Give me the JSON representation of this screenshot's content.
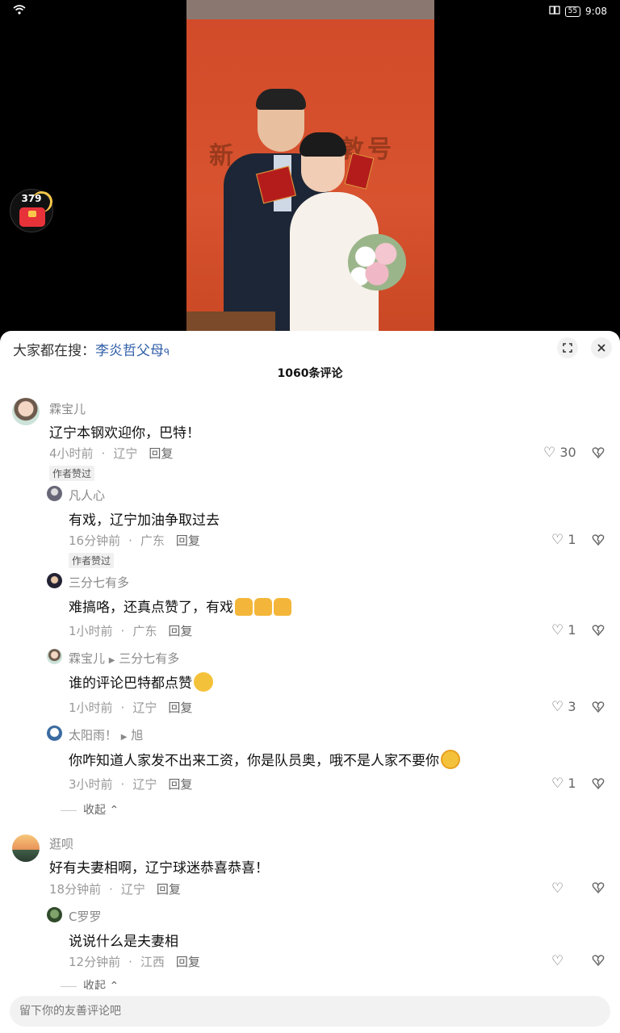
{
  "status_bar": {
    "time": "9:08",
    "battery": "55"
  },
  "red_packet": {
    "count": "379"
  },
  "search": {
    "prefix": "大家都在搜：",
    "keyword": "李炎哲父母"
  },
  "comments_count": "1060条评论",
  "comments": [
    {
      "name": "霖宝儿",
      "text": "辽宁本钢欢迎你，巴特！",
      "time": "4小时前",
      "region": "辽宁",
      "reply": "回复",
      "likes": "30",
      "badge": "作者赞过",
      "replies": [
        {
          "name": "凡人心",
          "text": "有戏，辽宁加油争取过去",
          "time": "16分钟前",
          "region": "广东",
          "reply": "回复",
          "likes": "1",
          "badge": "作者赞过"
        },
        {
          "name": "三分七有多",
          "text": "难搞咯，还真点赞了，有戏",
          "time": "1小时前",
          "region": "广东",
          "reply": "回复",
          "likes": "1"
        },
        {
          "name": "霖宝儿",
          "reply_to": "三分七有多",
          "text": "谁的评论巴特都点赞",
          "time": "1小时前",
          "region": "辽宁",
          "reply": "回复",
          "likes": "3"
        },
        {
          "name": "太阳雨！",
          "reply_to": "旭",
          "text": "你咋知道人家发不出来工资，你是队员奥，哦不是人家不要你",
          "time": "3小时前",
          "region": "辽宁",
          "reply": "回复",
          "likes": "1"
        }
      ],
      "collapse": "收起"
    },
    {
      "name": "逛呗",
      "text": "好有夫妻相啊，辽宁球迷恭喜恭喜！",
      "time": "18分钟前",
      "region": "辽宁",
      "reply": "回复",
      "likes": "",
      "replies": [
        {
          "name": "C罗罗",
          "text": "说说什么是夫妻相",
          "time": "12分钟前",
          "region": "江西",
          "reply": "回复",
          "likes": ""
        }
      ],
      "collapse": "收起"
    }
  ],
  "input": {
    "placeholder": "留下你的友善评论吧"
  },
  "colors": {
    "accent": "#2f5fa8",
    "backdrop": "#d24b2a"
  }
}
